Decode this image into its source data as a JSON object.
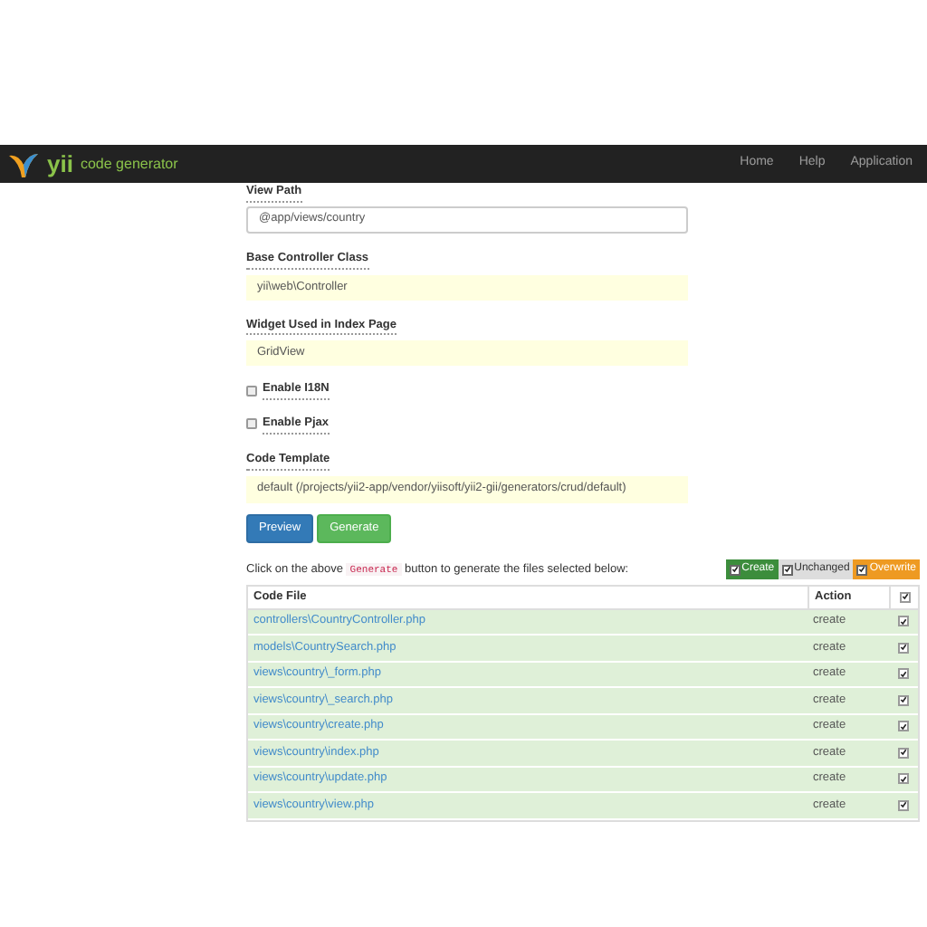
{
  "navbar": {
    "brand": "yii",
    "brand_suffix": "code generator",
    "links": [
      "Home",
      "Help",
      "Application"
    ]
  },
  "form": {
    "view_path": {
      "label": "View Path",
      "value": "@app/views/country"
    },
    "base_controller": {
      "label": "Base Controller Class",
      "value": "yii\\web\\Controller"
    },
    "widget": {
      "label": "Widget Used in Index Page",
      "value": "GridView"
    },
    "checkboxes": [
      {
        "label": "Enable I18N",
        "checked": false
      },
      {
        "label": "Enable Pjax",
        "checked": false
      }
    ],
    "template": {
      "label": "Code Template",
      "value": "default (/projects/yii2-app/vendor/yiisoft/yii2-gii/generators/crud/default)"
    },
    "buttons": [
      {
        "label": "Preview",
        "kind": "primary"
      },
      {
        "label": "Generate",
        "kind": "success"
      }
    ]
  },
  "hint": {
    "before": "Click on the above",
    "code": "Generate",
    "after": "button to generate the files selected below:"
  },
  "legend": [
    {
      "label": "Create",
      "checked": true,
      "color": "#3c8d3c"
    },
    {
      "label": "Unchanged",
      "checked": true,
      "color": "#dddddd"
    },
    {
      "label": "Overwrite",
      "checked": true,
      "color": "#ee9a22"
    }
  ],
  "table": {
    "columns": [
      "Code File",
      "Action"
    ],
    "all_checked": true,
    "rows": [
      {
        "file": "controllers\\CountryController.php",
        "action": "create",
        "checked": true
      },
      {
        "file": "models\\CountrySearch.php",
        "action": "create",
        "checked": true
      },
      {
        "file": "views\\country\\_form.php",
        "action": "create",
        "checked": true
      },
      {
        "file": "views\\country\\_search.php",
        "action": "create",
        "checked": true
      },
      {
        "file": "views\\country\\create.php",
        "action": "create",
        "checked": true
      },
      {
        "file": "views\\country\\index.php",
        "action": "create",
        "checked": true
      },
      {
        "file": "views\\country\\update.php",
        "action": "create",
        "checked": true
      },
      {
        "file": "views\\country\\view.php",
        "action": "create",
        "checked": true
      }
    ]
  }
}
